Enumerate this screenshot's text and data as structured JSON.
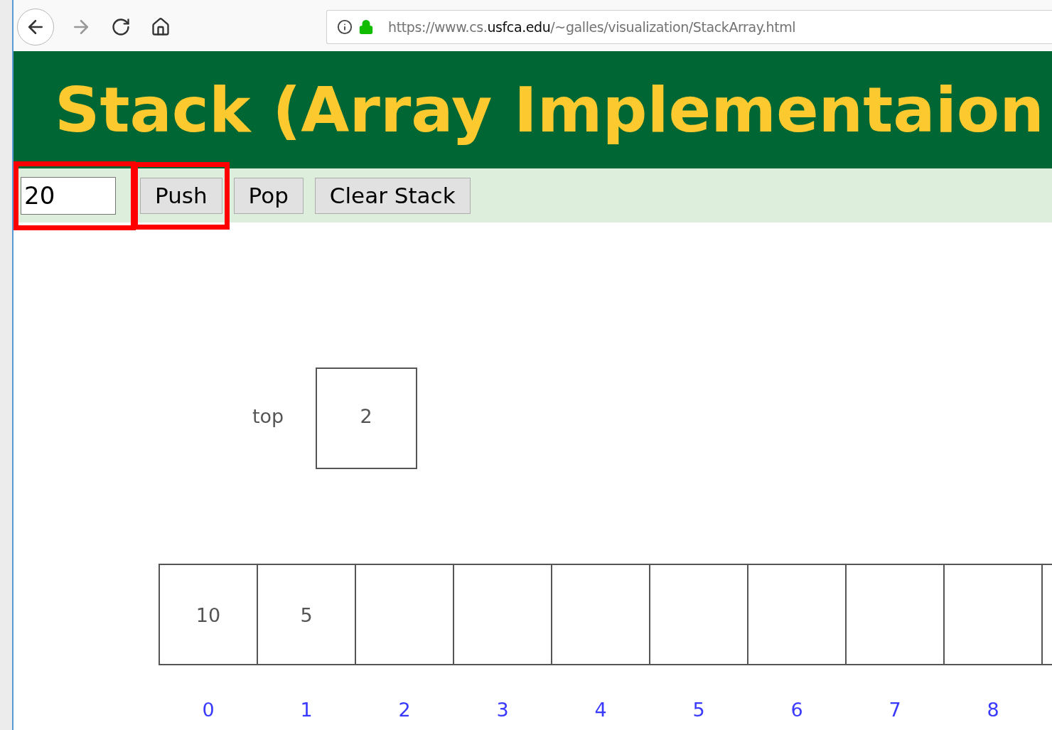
{
  "browser": {
    "url": {
      "prefix": "https://www.cs.",
      "domain": "usfca.edu",
      "suffix": "/~galles/visualization/StackArray.html"
    }
  },
  "header": {
    "title": "Stack (Array Implementaion"
  },
  "controls": {
    "input": {
      "value": "20",
      "highlighted": true
    },
    "buttons": [
      {
        "label": "Push",
        "highlighted": true
      },
      {
        "label": "Pop",
        "highlighted": false
      },
      {
        "label": "Clear Stack",
        "highlighted": false
      }
    ]
  },
  "visualization": {
    "top_label": "top",
    "top_value": "2",
    "cells": [
      {
        "value": "10",
        "index": "0"
      },
      {
        "value": "5",
        "index": "1"
      },
      {
        "index": "2"
      },
      {
        "index": "3"
      },
      {
        "index": "4"
      },
      {
        "index": "5"
      },
      {
        "index": "6"
      },
      {
        "index": "7"
      },
      {
        "index": "8"
      }
    ]
  }
}
